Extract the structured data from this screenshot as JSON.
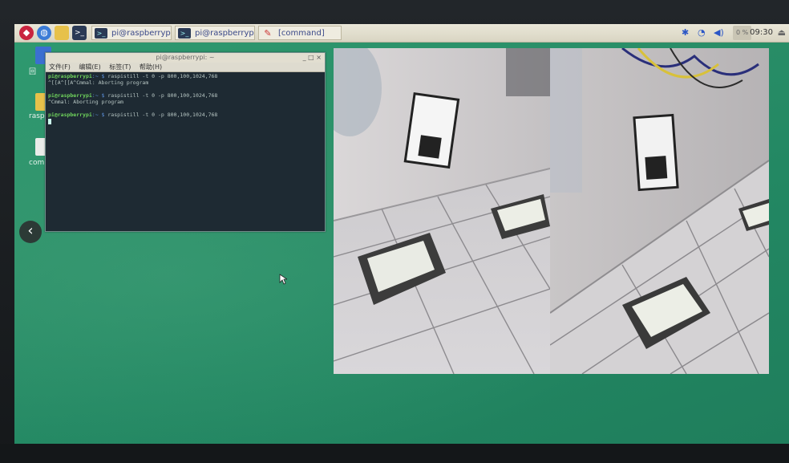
{
  "taskbar": {
    "menu_icon": "raspberry-icon",
    "browser_icon": "globe-icon",
    "files_icon": "folder-icon",
    "terminal_icon": "terminal-icon",
    "windows": [
      {
        "label": "pi@raspberrypi: ~",
        "icon": "terminal-icon"
      },
      {
        "label": "pi@raspberrypi: ~]",
        "icon": "terminal-icon"
      },
      {
        "label": "[command]",
        "icon": "pencil-icon"
      }
    ],
    "tray": {
      "bluetooth": "bluetooth-icon",
      "wifi": "wifi-icon",
      "volume": "volume-icon",
      "clock": "09:30",
      "eject": "eject-icon"
    }
  },
  "desktop": {
    "icons": [
      {
        "label": "回",
        "icon": "trash-icon"
      },
      {
        "label": "rasp",
        "icon": "folder-icon"
      },
      {
        "label": "comm",
        "icon": "file-icon"
      }
    ]
  },
  "terminal": {
    "title": "pi@raspberrypi: ~",
    "controls": "_ □ ×",
    "menu": [
      "文件(F)",
      "编辑(E)",
      "标签(T)",
      "帮助(H)"
    ],
    "lines": [
      {
        "prompt": "pi@raspberrypi",
        "path": ":~ $",
        "cmd": " raspistill -t 0 -p 800,100,1024,768"
      },
      {
        "prompt": "",
        "path": "",
        "cmd": "^[[A^[[A^Cmmal: Aborting program"
      },
      {
        "prompt": "pi@raspberrypi",
        "path": ":~ $",
        "cmd": " raspistill -t 0 -p 800,100,1024,768"
      },
      {
        "prompt": "",
        "path": "",
        "cmd": "^Cmmal: Aborting program"
      },
      {
        "prompt": "pi@raspberrypi",
        "path": ":~ $",
        "cmd": " raspistill -t 0 -p 800,100,1024,768"
      }
    ]
  },
  "back_button": "‹",
  "colors": {
    "desktop": "#2a8f68",
    "taskbar": "#e2ded0",
    "terminal_bg": "#1e2a33",
    "prompt": "#6fd35c"
  }
}
